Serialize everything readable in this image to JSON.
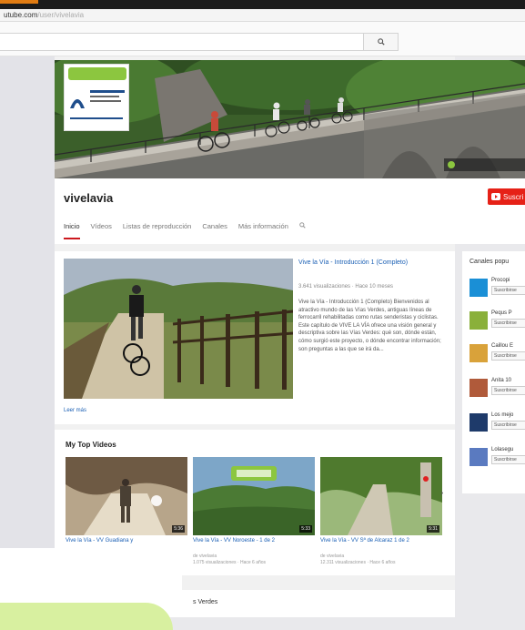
{
  "browser": {
    "url_host": "utube.com",
    "url_path": "/user/vivelavia"
  },
  "header": {
    "search_placeholder": ""
  },
  "channel": {
    "name": "vivelavia",
    "subscribe_label": "Suscri",
    "tabs": [
      {
        "label": "Inicio",
        "active": true
      },
      {
        "label": "Vídeos",
        "active": false
      },
      {
        "label": "Listas de reproducción",
        "active": false
      },
      {
        "label": "Canales",
        "active": false
      },
      {
        "label": "Más información",
        "active": false
      }
    ]
  },
  "featured": {
    "title": "Vive la Vía - Introducción 1 (Completo)",
    "meta": "3.641 visualizaciones · Hace 10 meses",
    "description": "Vive la Vía - Introducción 1 (Completo) Bienvenidos al atractivo mundo de las Vías Verdes, antiguas líneas de ferrocarril rehabilitadas como rutas senderistas y ciclistas. Este capítulo de VIVE LA VÍA ofrece una visión general y descriptiva sobre las Vías Verdes: qué son, dónde están, cómo surgió este proyecto, o dónde encontrar información; son preguntas a las que se irá da...",
    "read_more": "Leer más"
  },
  "top_videos": {
    "title": "My Top Videos",
    "videos": [
      {
        "title": "Vive la Vía - VV Guadiana y",
        "duration": "5:36",
        "meta": [
          "",
          ""
        ]
      },
      {
        "title": "Vive la Vía - VV Noroeste - 1 de 2",
        "duration": "5:33",
        "meta": [
          "de vivelavia",
          "1.075 visualizaciones · Hace 6 años"
        ]
      },
      {
        "title": "Vive la Vía - VV Sª de Alcaraz 1 de 2",
        "duration": "5:31",
        "meta": [
          "de vivelavia",
          "12.311 visualizaciones · Hace 6 años"
        ]
      }
    ]
  },
  "bottom": {
    "title": "s Verdes"
  },
  "sidebar": {
    "title": "Canales popu",
    "items": [
      {
        "name": "Procopi",
        "sub": "Suscribirse",
        "color": "#1a8fd6"
      },
      {
        "name": "Pequs P",
        "sub": "Suscribirse",
        "color": "#8ab03a"
      },
      {
        "name": "Caillou E",
        "sub": "Suscribirse",
        "color": "#d9a23a"
      },
      {
        "name": "Anita 10",
        "sub": "Suscribirse",
        "color": "#b05a3a"
      },
      {
        "name": "Los mejo",
        "sub": "Suscribirse",
        "color": "#1e3a6a"
      },
      {
        "name": "Lolasegu",
        "sub": "Suscribirse",
        "color": "#5a7ac0"
      }
    ]
  },
  "colors": {
    "accent": "#cc181e",
    "link": "#1a5fb4",
    "logo_green": "#8cc63f"
  }
}
